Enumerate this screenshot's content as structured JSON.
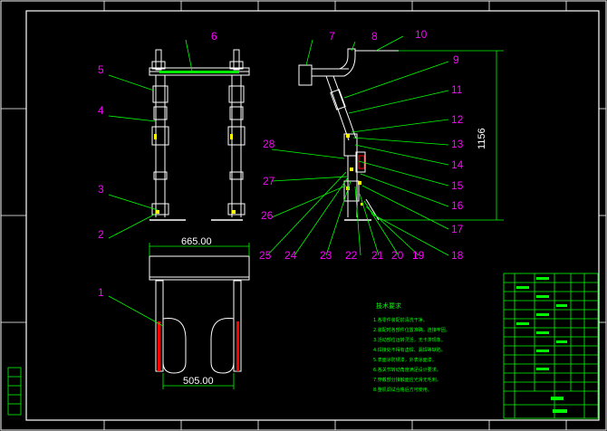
{
  "part_labels": [
    "1",
    "2",
    "3",
    "4",
    "5",
    "6",
    "7",
    "8",
    "9",
    "10",
    "11",
    "12",
    "13",
    "14",
    "15",
    "16",
    "17",
    "18",
    "19",
    "20",
    "21",
    "22",
    "23",
    "24",
    "25",
    "26",
    "27",
    "28"
  ],
  "dimensions": {
    "top_width": "665.00",
    "bottom_width": "505.00",
    "height": "1156"
  },
  "notes": {
    "title": "技术要求",
    "lines": [
      "1.各零件装配前清洗干净。",
      "2.装配时各部件位置准确，连接牢固。",
      "3.活动部位运转灵活，无卡滞现象。",
      "4.焊接处不得有虚焊、漏焊等缺陷。",
      "5.表面涂防锈漆，外表涂面漆。",
      "6.各关节转动角度满足设计要求。",
      "7.穿戴部分接触面应光滑无毛刺。",
      "8.整机调试合格后方可使用。"
    ]
  },
  "colors": {
    "lines": "#ffffff",
    "labels": "#ff00ff",
    "leaders": "#00ff00",
    "frame": "#ffffff",
    "table": "#00ff00",
    "dim": "#ff0000"
  }
}
